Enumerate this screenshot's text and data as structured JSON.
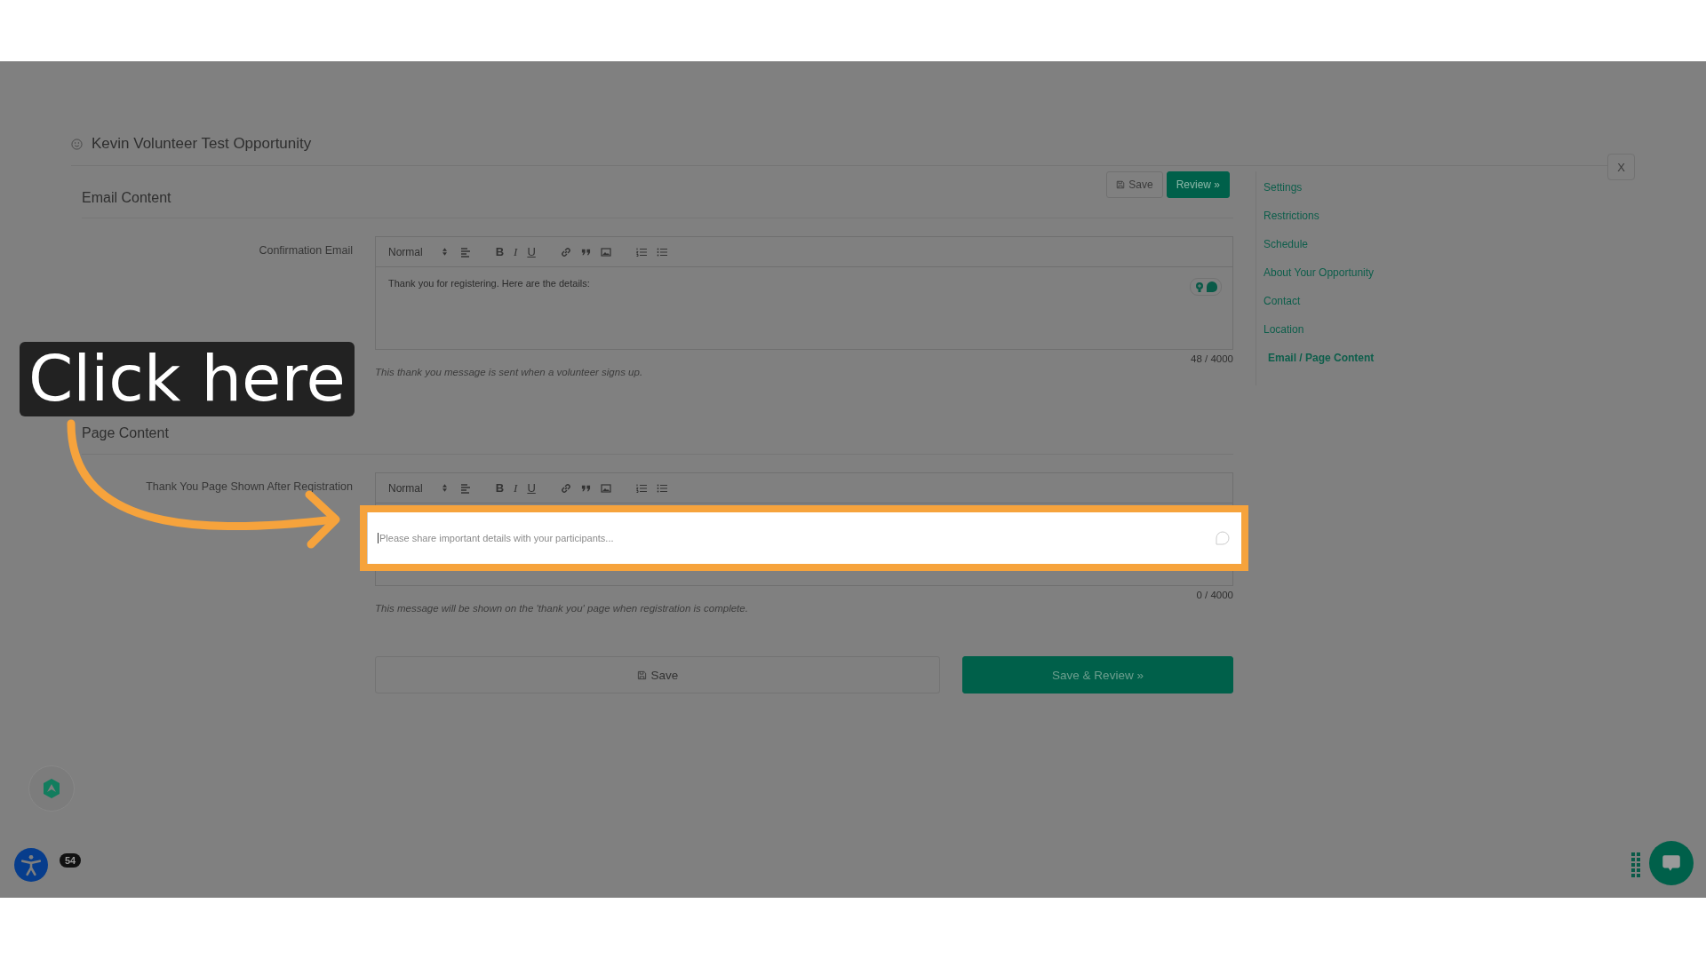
{
  "header": {
    "title": "Kevin Volunteer Test Opportunity",
    "close": "X"
  },
  "top_buttons": [
    {
      "label": "Save",
      "kind": "secondary"
    },
    {
      "label": "Review »",
      "kind": "primary"
    }
  ],
  "sections": [
    {
      "heading": "Email Content",
      "field": {
        "label": "Confirmation Email",
        "format": "Normal",
        "style_buttons": [
          "B",
          "I",
          "U"
        ],
        "value": "Thank you for registering. Here are the details:",
        "count": "48 / 4000",
        "help": "This thank you message is sent when a volunteer signs up.",
        "highlighted": false
      }
    },
    {
      "heading": "Page Content",
      "field": {
        "label": "Thank You Page Shown After Registration",
        "format": "Normal",
        "style_buttons": [
          "B",
          "I",
          "U"
        ],
        "placeholder": "Please share important details with your participants...",
        "count": "0 / 4000",
        "help": "This message will be shown on the 'thank you' page when registration is complete.",
        "highlighted": true
      }
    }
  ],
  "actions": [
    {
      "label": "Save",
      "kind": "secondary"
    },
    {
      "label": "Save & Review »",
      "kind": "primary"
    }
  ],
  "sidebar": {
    "items": [
      {
        "label": "Settings",
        "selected": false
      },
      {
        "label": "Restrictions",
        "selected": false
      },
      {
        "label": "Schedule",
        "selected": false
      },
      {
        "label": "About Your Opportunity",
        "selected": false
      },
      {
        "label": "Contact",
        "selected": false
      },
      {
        "label": "Location",
        "selected": false
      },
      {
        "label": "Email / Page Content",
        "selected": true
      }
    ]
  },
  "tooltip": {
    "text": "Click here"
  },
  "widgets": {
    "badge": "54"
  }
}
